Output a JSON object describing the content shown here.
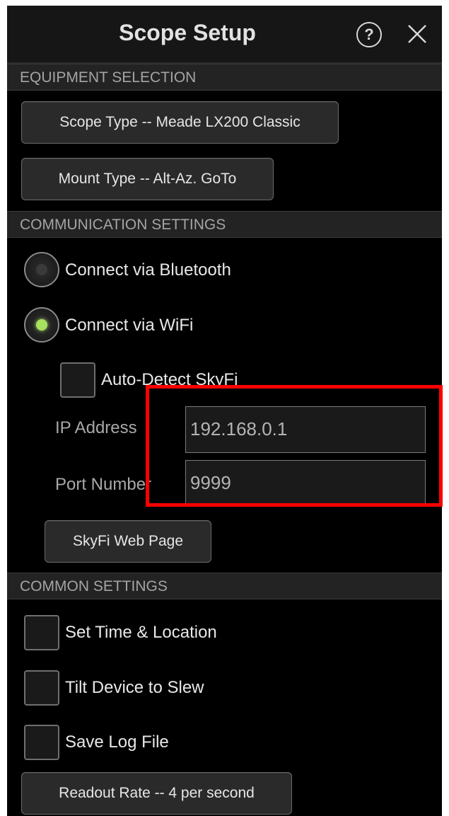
{
  "header": {
    "title": "Scope Setup",
    "help_glyph": "?",
    "close_icon": "close-icon"
  },
  "equipment": {
    "section_label": "EQUIPMENT SELECTION",
    "scope_type_label": "Scope Type -- Meade LX200 Classic",
    "mount_type_label": "Mount Type -- Alt-Az. GoTo"
  },
  "communication": {
    "section_label": "COMMUNICATION SETTINGS",
    "bluetooth_label": "Connect via Bluetooth",
    "bluetooth_selected": false,
    "wifi_label": "Connect via WiFi",
    "wifi_selected": true,
    "auto_detect_label": "Auto-Detect SkyFi",
    "auto_detect_checked": false,
    "ip_label": "IP Address",
    "ip_value": "192.168.0.1",
    "port_label": "Port Number",
    "port_value": "9999",
    "web_page_button": "SkyFi Web Page"
  },
  "common": {
    "section_label": "COMMON SETTINGS",
    "time_location_label": "Set Time & Location",
    "time_location_checked": false,
    "tilt_label": "Tilt Device to Slew",
    "tilt_checked": false,
    "save_log_label": "Save Log File",
    "save_log_checked": false,
    "readout_rate_label": "Readout Rate -- 4 per second"
  },
  "colors": {
    "selected_radio_dot": "#a8e060",
    "unselected_radio_dot": "#3a3a3a",
    "highlight_box": "#ff0000"
  }
}
